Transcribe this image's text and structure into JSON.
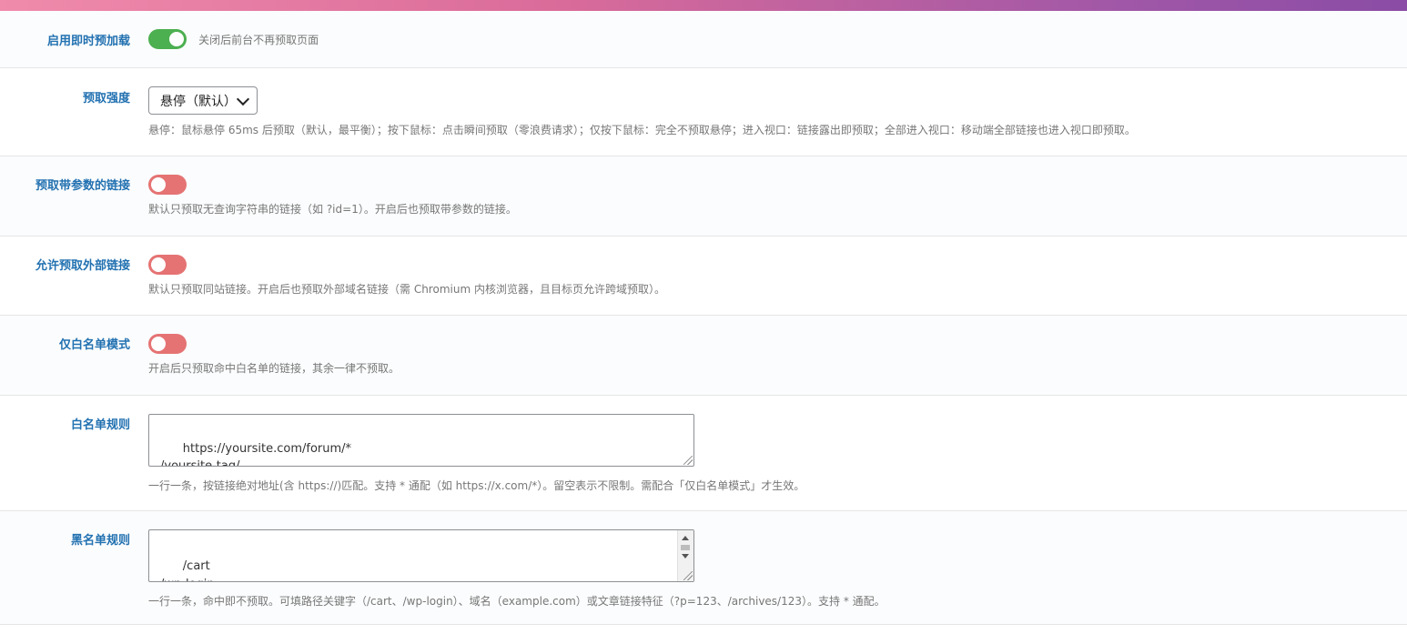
{
  "settings": {
    "instant_preload": {
      "label": "启用即时预加载",
      "enabled": true,
      "desc": "关闭后前台不再预取页面"
    },
    "prefetch_strength": {
      "label": "预取强度",
      "selected": "悬停（默认）",
      "desc": "悬停：鼠标悬停 65ms 后预取（默认，最平衡）；按下鼠标：点击瞬间预取（零浪费请求）；仅按下鼠标：完全不预取悬停；进入视口：链接露出即预取；全部进入视口：移动端全部链接也进入视口即预取。"
    },
    "param_links": {
      "label": "预取带参数的链接",
      "enabled": false,
      "desc": "默认只预取无查询字符串的链接（如 ?id=1）。开启后也预取带参数的链接。"
    },
    "external_links": {
      "label": "允许预取外部链接",
      "enabled": false,
      "desc": "默认只预取同站链接。开启后也预取外部域名链接（需 Chromium 内核浏览器，且目标页允许跨域预取）。"
    },
    "whitelist_mode": {
      "label": "仅白名单模式",
      "enabled": false,
      "desc": "开启后只预取命中白名单的链接，其余一律不预取。"
    },
    "whitelist_rules": {
      "label": "白名单规则",
      "value": "https://yoursite.com/forum/*\n/yoursite-tag/",
      "desc": "一行一条，按链接绝对地址(含 https://)匹配。支持 * 通配（如 https://x.com/*）。留空表示不限制。需配合「仅白名单模式」才生效。"
    },
    "blacklist_rules": {
      "label": "黑名单规则",
      "value": "/cart\n/wp-login\n?add-to-cart",
      "desc": "一行一条，命中即不预取。可填路径关键字（/cart、/wp-login）、域名（example.com）或文章链接特征（?p=123、/archives/123）。支持 * 通配。"
    }
  },
  "colors": {
    "toggle_on": "#4caf50",
    "toggle_off": "#e57373",
    "label": "#2271b1"
  }
}
